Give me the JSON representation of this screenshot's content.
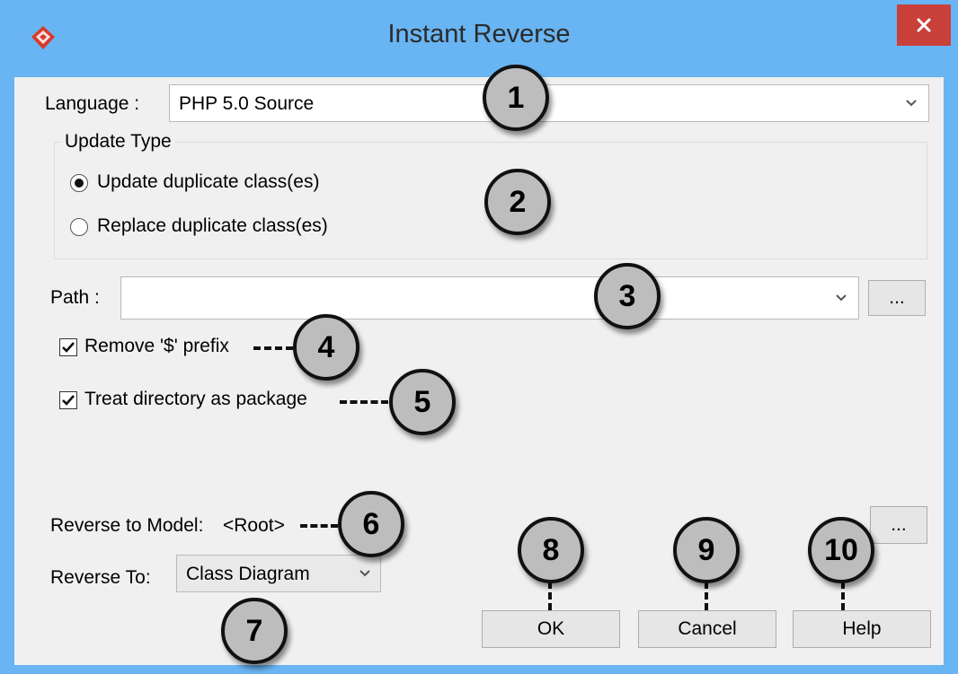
{
  "window": {
    "title": "Instant Reverse"
  },
  "language": {
    "label": "Language :",
    "value": "PHP 5.0 Source"
  },
  "update_type": {
    "title": "Update Type",
    "options": [
      {
        "label": "Update duplicate class(es)",
        "selected": true
      },
      {
        "label": "Replace duplicate class(es)",
        "selected": false
      }
    ]
  },
  "path": {
    "label": "Path :",
    "value": "",
    "browse_label": "..."
  },
  "options": {
    "remove_prefix": {
      "label": "Remove '$' prefix",
      "checked": true
    },
    "treat_directory": {
      "label": "Treat directory as package",
      "checked": true
    }
  },
  "reverse_model": {
    "label": "Reverse to Model:",
    "value": "<Root>",
    "browse_label": "..."
  },
  "reverse_to": {
    "label": "Reverse To:",
    "value": "Class Diagram"
  },
  "buttons": {
    "ok": "OK",
    "cancel": "Cancel",
    "help": "Help"
  },
  "callouts": [
    "1",
    "2",
    "3",
    "4",
    "5",
    "6",
    "7",
    "8",
    "9",
    "10"
  ],
  "colors": {
    "titlebar": "#69b4f2",
    "close": "#c9403a",
    "client": "#f0f0f0",
    "callout": "#bdbdbd"
  },
  "icons": {
    "app": "visual-paradigm-logo-icon",
    "close": "close-icon",
    "dropdown": "chevron-down-icon"
  }
}
